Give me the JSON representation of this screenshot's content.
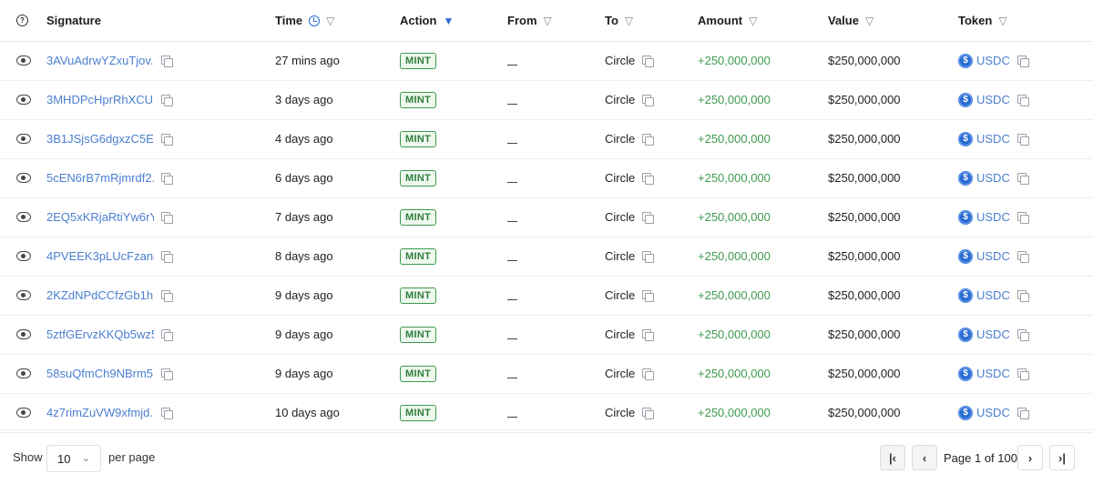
{
  "headers": {
    "signature": "Signature",
    "time": "Time",
    "action": "Action",
    "from": "From",
    "to": "To",
    "amount": "Amount",
    "value": "Value",
    "token": "Token"
  },
  "rows": [
    {
      "signature": "3AVuAdrwYZxuTjov...",
      "time": "27 mins ago",
      "action": "MINT",
      "from": "__",
      "to": "Circle",
      "amount": "+250,000,000",
      "value": "$250,000,000",
      "token": "USDC"
    },
    {
      "signature": "3MHDPcHprRhXCU...",
      "time": "3 days ago",
      "action": "MINT",
      "from": "__",
      "to": "Circle",
      "amount": "+250,000,000",
      "value": "$250,000,000",
      "token": "USDC"
    },
    {
      "signature": "3B1JSjsG6dgxzC5E...",
      "time": "4 days ago",
      "action": "MINT",
      "from": "__",
      "to": "Circle",
      "amount": "+250,000,000",
      "value": "$250,000,000",
      "token": "USDC"
    },
    {
      "signature": "5cEN6rB7mRjmrdf2...",
      "time": "6 days ago",
      "action": "MINT",
      "from": "__",
      "to": "Circle",
      "amount": "+250,000,000",
      "value": "$250,000,000",
      "token": "USDC"
    },
    {
      "signature": "2EQ5xKRjaRtiYw6rY...",
      "time": "7 days ago",
      "action": "MINT",
      "from": "__",
      "to": "Circle",
      "amount": "+250,000,000",
      "value": "$250,000,000",
      "token": "USDC"
    },
    {
      "signature": "4PVEEK3pLUcFzan4...",
      "time": "8 days ago",
      "action": "MINT",
      "from": "__",
      "to": "Circle",
      "amount": "+250,000,000",
      "value": "$250,000,000",
      "token": "USDC"
    },
    {
      "signature": "2KZdNPdCCfzGb1h...",
      "time": "9 days ago",
      "action": "MINT",
      "from": "__",
      "to": "Circle",
      "amount": "+250,000,000",
      "value": "$250,000,000",
      "token": "USDC"
    },
    {
      "signature": "5ztfGErvzKKQb5wz5...",
      "time": "9 days ago",
      "action": "MINT",
      "from": "__",
      "to": "Circle",
      "amount": "+250,000,000",
      "value": "$250,000,000",
      "token": "USDC"
    },
    {
      "signature": "58suQfmCh9NBrm5...",
      "time": "9 days ago",
      "action": "MINT",
      "from": "__",
      "to": "Circle",
      "amount": "+250,000,000",
      "value": "$250,000,000",
      "token": "USDC"
    },
    {
      "signature": "4z7rimZuVW9xfmjd...",
      "time": "10 days ago",
      "action": "MINT",
      "from": "__",
      "to": "Circle",
      "amount": "+250,000,000",
      "value": "$250,000,000",
      "token": "USDC"
    }
  ],
  "footer": {
    "show_label": "Show",
    "page_size": "10",
    "per_page_label": "per page",
    "page_info": "Page 1 of 100"
  },
  "colors": {
    "link": "#4a7fd0",
    "amount": "#3e9a4e",
    "badge": "#3d9a4b",
    "active_filter": "#2a6bd1"
  },
  "icons": {
    "help": "question-circle-icon",
    "filter": "funnel-icon",
    "time": "clock-icon",
    "view": "eye-icon",
    "copy": "copy-icon",
    "token": "usdc-coin-icon"
  }
}
